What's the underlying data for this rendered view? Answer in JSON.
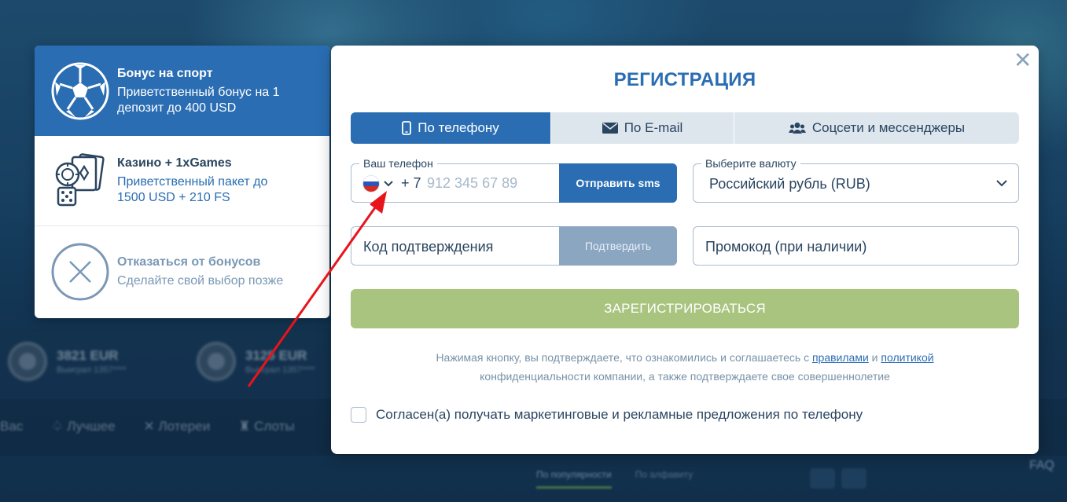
{
  "background": {
    "wins": [
      {
        "amount": "3821 EUR",
        "sub": "Выиграл 1357****"
      },
      {
        "amount": "3125 EUR",
        "sub": "Выиграл 1357****"
      }
    ],
    "nav": [
      "Вас",
      "Лучшее",
      "Лотереи",
      "Слоты"
    ],
    "sort": {
      "popular": "По популярности",
      "alpha": "По алфавиту"
    },
    "faq": "FAQ"
  },
  "bonuses": [
    {
      "title": "Бонус на спорт",
      "desc": "Приветственный бонус на 1 депозит до 400 USD",
      "icon": "football-icon",
      "active": true
    },
    {
      "title": "Казино + 1xGames",
      "desc": "Приветственный пакет до 1500 USD + 210 FS",
      "icon": "casino-icon",
      "active": false
    },
    {
      "title": "Отказаться от бонусов",
      "desc": "Сделайте свой выбор позже",
      "icon": "decline-x-icon",
      "active": false
    }
  ],
  "modal": {
    "title": "РЕГИСТРАЦИЯ",
    "close_icon": "close-icon",
    "tabs": [
      {
        "label": "По телефону",
        "icon": "phone-icon",
        "active": true
      },
      {
        "label": "По E-mail",
        "icon": "mail-icon",
        "active": false
      },
      {
        "label": "Соцсети и мессенджеры",
        "icon": "users-icon",
        "active": false
      }
    ],
    "phone": {
      "legend": "Ваш телефон",
      "country_code": "+ 7",
      "placeholder": "912 345 67 89",
      "send_sms": "Отправить sms",
      "flag": "russia-flag-icon"
    },
    "currency": {
      "legend": "Выберите валюту",
      "value": "Российский рубль (RUB)"
    },
    "confirm_code": {
      "placeholder": "Код подтверждения",
      "button": "Подтвердить"
    },
    "promo": {
      "placeholder": "Промокод (при наличии)"
    },
    "register": "ЗАРЕГИСТРИРОВАТЬСЯ",
    "terms": {
      "part1": "Нажимая кнопку, вы подтверждаете, что ознакомились и соглашаетесь с ",
      "rules_link": "правилами",
      "and": " и ",
      "policy_link": "политикой",
      "part2": "конфиденциальности компании, а также подтверждаете свое совершеннолетие"
    },
    "consent": "Согласен(а) получать маркетинговые и рекламные предложения по телефону"
  },
  "colors": {
    "accent": "#2a6db3",
    "register_button": "#a9c47f",
    "annotation_arrow": "#e8141b"
  }
}
